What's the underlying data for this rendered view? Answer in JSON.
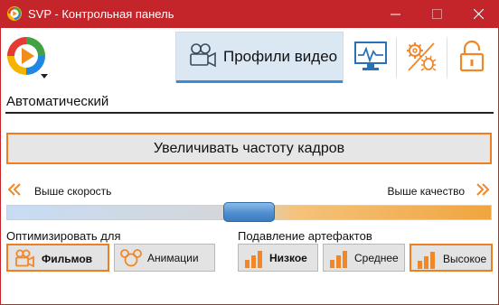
{
  "window": {
    "title": "SVP - Контрольная панель",
    "accent_color": "#c4252a"
  },
  "toolbar": {
    "logo_icon": "svp-logo-icon",
    "active_tab": {
      "label": "Профили видео",
      "icon": "movie-camera-icon"
    },
    "buttons": [
      {
        "name": "monitor-icon"
      },
      {
        "name": "settings-bug-icon"
      },
      {
        "name": "unlock-icon"
      }
    ]
  },
  "profile": {
    "name": "Автоматический"
  },
  "main_action": {
    "label": "Увеличивать частоту кадров",
    "border_color": "#ef7e20"
  },
  "slider": {
    "left_label": "Выше скорость",
    "right_label": "Выше качество",
    "value_fraction": 0.5
  },
  "optimize": {
    "label": "Оптимизировать для",
    "options": [
      {
        "label": "Фильмов",
        "icon": "film-camera-icon",
        "selected": true
      },
      {
        "label": "Анимации",
        "icon": "mouse-ears-icon",
        "selected": false
      }
    ]
  },
  "artifacts": {
    "label": "Подавление артефактов",
    "options": [
      {
        "label": "Низкое",
        "icon": "bars-low-icon",
        "selected": false
      },
      {
        "label": "Среднее",
        "icon": "bars-mid-icon",
        "selected": false
      },
      {
        "label": "Высокое",
        "icon": "bars-high-icon",
        "selected": true
      }
    ]
  }
}
